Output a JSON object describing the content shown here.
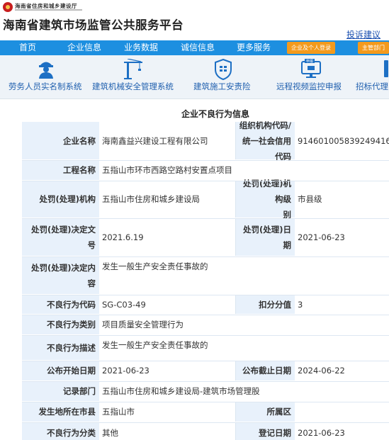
{
  "header": {
    "department": "海南省住房和城乡建设厅",
    "site_title": "海南省建筑市场监管公共服务平台",
    "complaint_link": "投诉建议"
  },
  "nav": {
    "items": [
      "首页",
      "企业信息",
      "业务数据",
      "诚信信息",
      "更多服务"
    ],
    "enterprise_login": "企业及个人登录",
    "dept_login": "主管部门"
  },
  "systems": [
    {
      "label": "劳务人员实名制系统",
      "icon": "worker-helmet-icon"
    },
    {
      "label": "建筑机械安全管理系统",
      "icon": "tower-crane-icon"
    },
    {
      "label": "建筑施工安责险",
      "icon": "insurance-shield-icon"
    },
    {
      "label": "远程视频监控申报",
      "icon": "video-monitor-icon"
    },
    {
      "label": "招标代理",
      "icon": "bid-agency-icon"
    }
  ],
  "section_title": "企业不良行为信息",
  "record": {
    "company_name_label": "企业名称",
    "company_name": "海南鑫益兴建设工程有限公司",
    "org_code_label_1": "组织机构代码/",
    "org_code_label_2": "统一社会信用代码",
    "org_code": "914601005839249416",
    "project_label": "工程名称",
    "project": "五指山市环市西路空路村安置点项目",
    "punish_org_label": "处罚(处理)机构",
    "punish_org": "五指山市住房和城乡建设局",
    "punish_level_label_1": "处罚(处理)机构级",
    "punish_level_label_2": "别",
    "punish_level": "市县级",
    "decision_no_label_1": "处罚(处理)决定文",
    "decision_no_label_2": "号",
    "decision_no": "2021.6.19",
    "punish_date_label": "处罚(处理)日期",
    "punish_date": "2021-06-23",
    "decision_content_label_1": "处罚(处理)决定内",
    "decision_content_label_2": "容",
    "decision_content": "发生一般生产安全责任事故的",
    "behavior_code_label": "不良行为代码",
    "behavior_code": "SG-C03-49",
    "deduct_label": "扣分分值",
    "deduct": "3",
    "behavior_type_label": "不良行为类别",
    "behavior_type": "项目质量安全管理行为",
    "behavior_desc_label": "不良行为描述",
    "behavior_desc": "发生一般生产安全责任事故的",
    "publish_start_label": "公布开始日期",
    "publish_start": "2021-06-23",
    "publish_end_label": "公布截止日期",
    "publish_end": "2024-06-22",
    "record_dept_label": "记录部门",
    "record_dept": "五指山市住房和城乡建设局-建筑市场管理股",
    "city_label": "发生地所在市县",
    "city": "五指山市",
    "district_label": "所属区",
    "district": "",
    "category_label": "不良行为分类",
    "category": "其他",
    "register_date_label": "登记日期",
    "register_date": "2021-06-23"
  }
}
